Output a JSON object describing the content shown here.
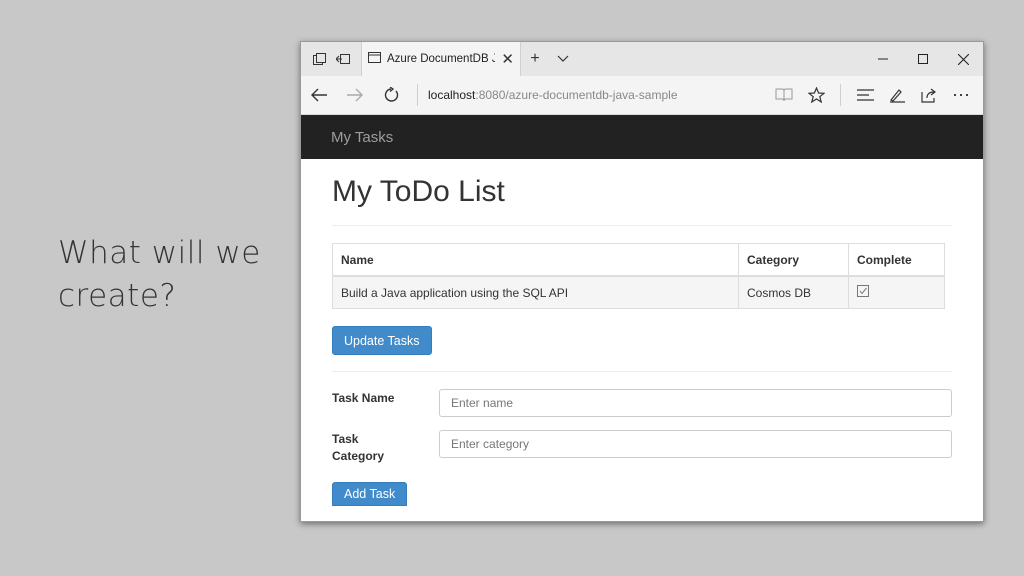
{
  "slide": {
    "title": "What will we create?"
  },
  "browser": {
    "tab_title": "Azure DocumentDB Jav",
    "address_host": "localhost",
    "address_path": ":8080/azure-documentdb-java-sample"
  },
  "navbar": {
    "brand": "My Tasks"
  },
  "page": {
    "heading": "My ToDo List"
  },
  "table": {
    "headers": [
      "Name",
      "Category",
      "Complete"
    ],
    "rows": [
      {
        "name": "Build a Java application using the SQL API",
        "category": "Cosmos DB",
        "complete": true
      }
    ]
  },
  "buttons": {
    "update": "Update Tasks",
    "add": "Add Task"
  },
  "form": {
    "task_name_label": "Task Name",
    "task_name_placeholder": "Enter name",
    "task_category_label_line1": "Task",
    "task_category_label_line2": "Category",
    "task_category_placeholder": "Enter category"
  },
  "icons": {
    "tab_preview": "tab-preview-icon",
    "set_aside": "set-aside-tabs-icon",
    "page": "page-icon",
    "back": "back-arrow-icon",
    "forward": "forward-arrow-icon",
    "refresh": "refresh-icon",
    "reading_view": "reading-view-icon",
    "favorite": "star-icon",
    "hub": "hub-icon",
    "notes": "web-note-icon",
    "share": "share-icon",
    "more": "more-icon"
  },
  "colors": {
    "navbar_bg": "#222222",
    "primary": "#428bca",
    "slide_bg": "#c8c8c8"
  }
}
